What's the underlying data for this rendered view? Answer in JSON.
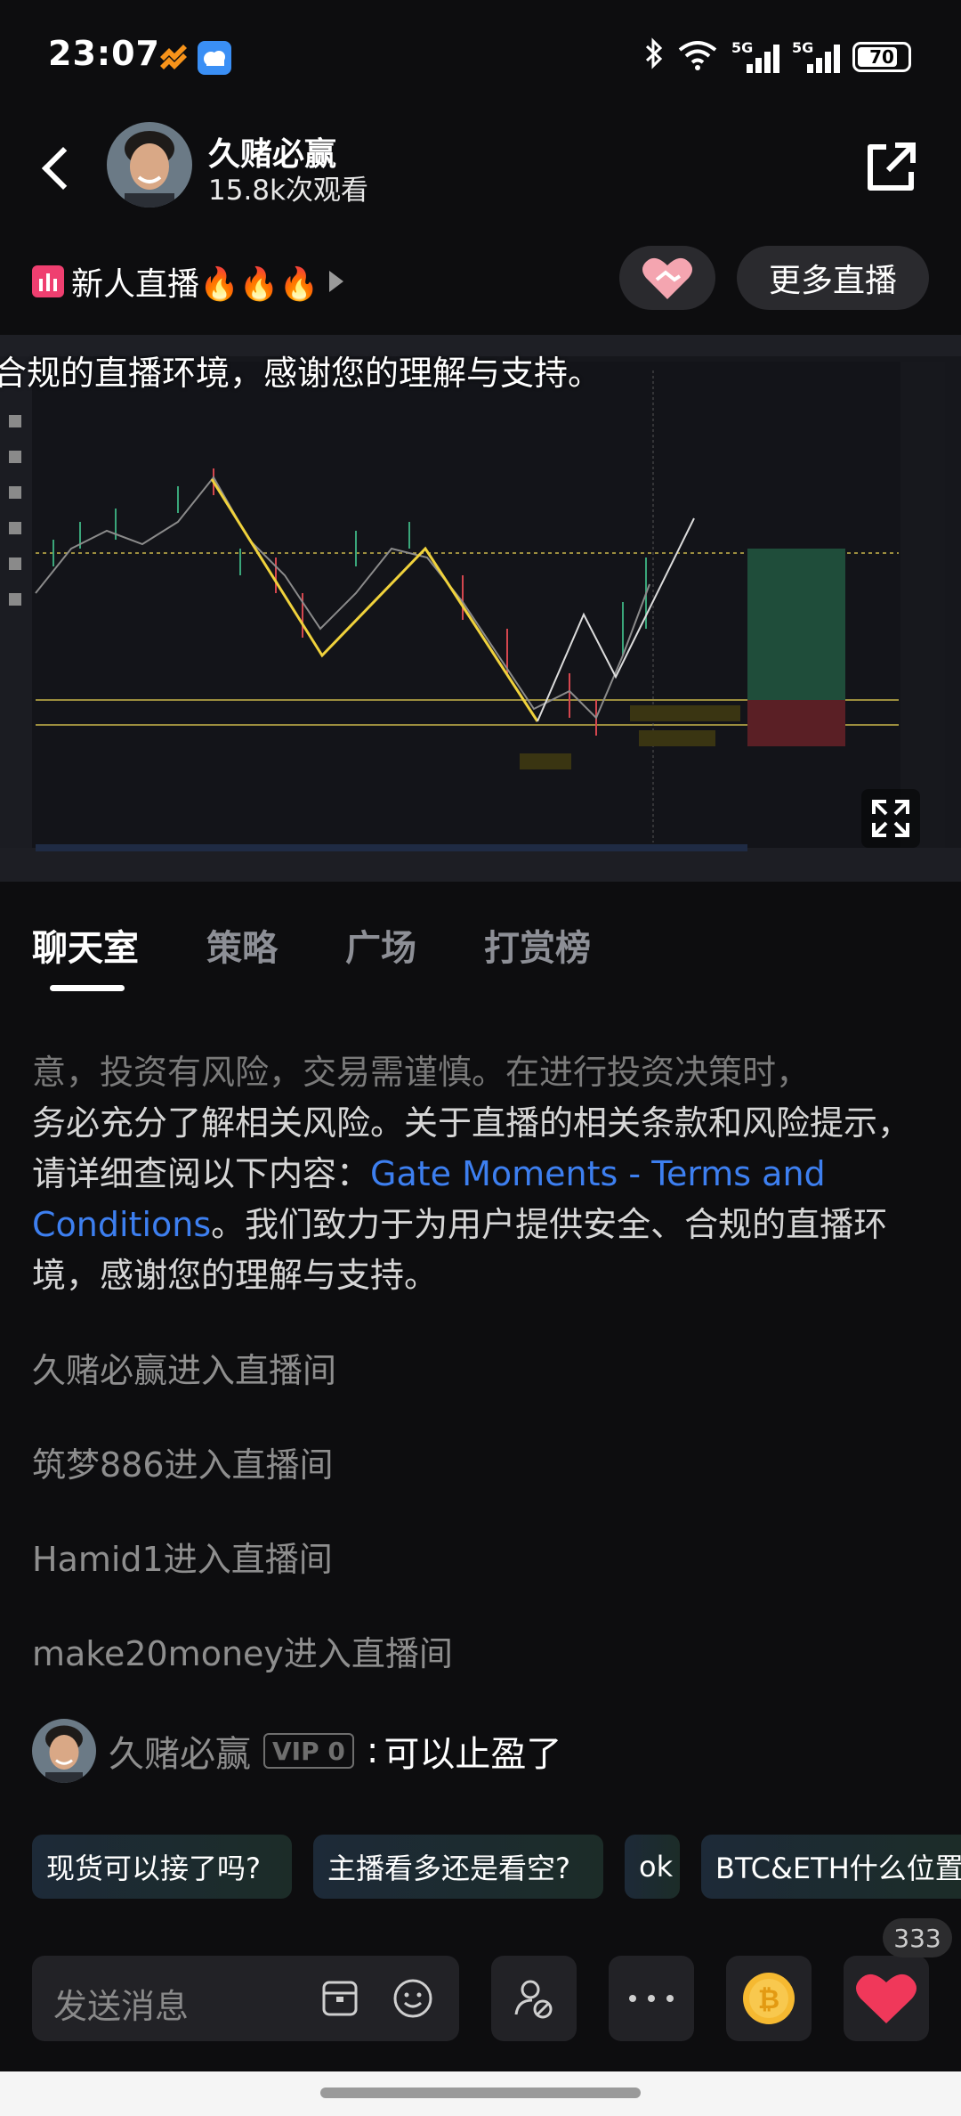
{
  "status_bar": {
    "time": "23:07",
    "network_label": "5G",
    "battery": "70"
  },
  "header": {
    "host_name": "久赌必赢",
    "view_count": "15.8k次观看"
  },
  "tags": {
    "live_label": "新人直播🔥🔥🔥",
    "more_live_label": "更多直播"
  },
  "video": {
    "caption": "合规的直播环境，感谢您的理解与支持。"
  },
  "tabs": [
    {
      "label": "聊天室"
    },
    {
      "label": "策略"
    },
    {
      "label": "广场"
    },
    {
      "label": "打赏榜"
    }
  ],
  "chat": {
    "notice_fade": "意，投资有风险，交易需谨慎。在进行投资决策时，",
    "notice_main": "务必充分了解相关风险。关于直播的相关条款和风险提示，请详细查阅以下内容：",
    "notice_link": "Gate Moments - Terms and Conditions",
    "notice_tail": "。我们致力于为用户提供安全、合规的直播环境，感谢您的理解与支持。",
    "enter_messages": [
      {
        "text": "久赌必赢进入直播间"
      },
      {
        "text": "筑梦886进入直播间"
      },
      {
        "text": "Hamid1进入直播间"
      },
      {
        "text": "make20money进入直播间"
      }
    ],
    "message": {
      "user": "久赌必赢",
      "vip": "VIP 0",
      "colon": ":",
      "text": "可以止盈了"
    }
  },
  "quick_replies": [
    {
      "label": "现货可以接了吗?"
    },
    {
      "label": "主播看多还是看空?"
    },
    {
      "label": "ok"
    },
    {
      "label": "BTC&ETH什么位置"
    }
  ],
  "bottom_bar": {
    "input_placeholder": "发送消息",
    "like_count": "333"
  },
  "colors": {
    "background": "#0d0d0f",
    "link": "#3d7ff0",
    "live_badge": "#ef3f70",
    "heart": "#f0385a",
    "coin": "#f5b931"
  }
}
